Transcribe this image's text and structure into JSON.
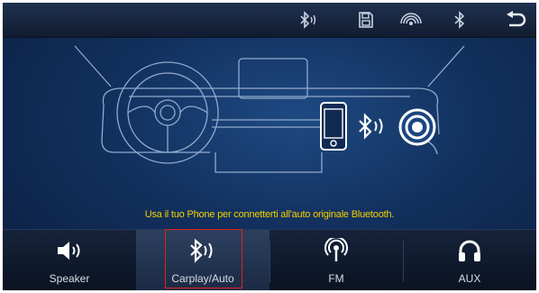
{
  "topbar": {
    "buttons": [
      {
        "name": "bluetooth-audio-icon"
      },
      {
        "name": "sd-card-icon"
      },
      {
        "name": "signal-icon"
      },
      {
        "name": "bluetooth-icon"
      },
      {
        "name": "back-icon"
      }
    ]
  },
  "illustration": {
    "phone_icon": "smartphone-icon",
    "signal_icon": "bluetooth-audio-icon",
    "speaker_icon": "speaker-target-icon"
  },
  "message": "Usa il tuo Phone per connetterti all'auto originale Bluetooth.",
  "bottom_nav": {
    "items": [
      {
        "label": "Speaker",
        "icon": "speaker-icon"
      },
      {
        "label": "Carplay/Auto",
        "icon": "bluetooth-audio-icon",
        "selected": true
      },
      {
        "label": "FM",
        "icon": "radio-icon"
      },
      {
        "label": "AUX",
        "icon": "headphones-icon"
      }
    ]
  },
  "colors": {
    "message_text": "#f3d100",
    "highlight_border": "#e02020",
    "line_art": "#9fb6d8",
    "icon_white": "#ffffff"
  }
}
